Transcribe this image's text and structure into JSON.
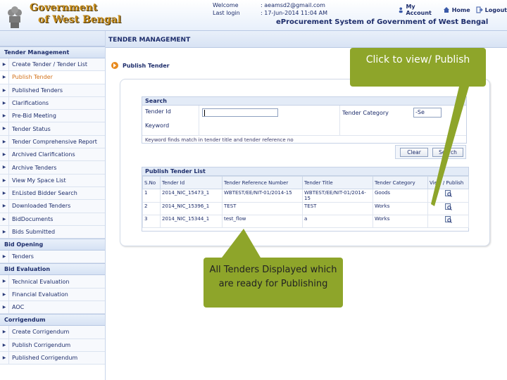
{
  "header": {
    "logo_line1": "Government",
    "logo_line2": "of West Bengal",
    "welcome_label": "Welcome",
    "welcome_value": ": aeamsd2@gmail.com",
    "lastlogin_label": "Last login",
    "lastlogin_value": ": 17-Jun-2014 11:04 AM",
    "links": {
      "account": "My Account",
      "home": "Home",
      "logout": "Logout"
    },
    "system_title": "eProcurement System of Government of West Bengal"
  },
  "sidebar": {
    "sections": [
      {
        "title": "Tender Management",
        "items": [
          "Create Tender / Tender List",
          "Publish Tender",
          "Published Tenders",
          "Clarifications",
          "Pre-Bid Meeting",
          "Tender Status",
          "Tender Comprehensive Report",
          "Archived Clarifications",
          "Archive Tenders",
          "View My Space List",
          "EnListed Bidder Search",
          "Downloaded Tenders",
          "BidDocuments",
          "Bids Submitted"
        ]
      },
      {
        "title": "Bid Opening",
        "items": [
          "Tenders"
        ]
      },
      {
        "title": "Bid Evaluation",
        "items": [
          "Technical Evaluation",
          "Financial Evaluation",
          "AOC"
        ]
      },
      {
        "title": "Corrigendum",
        "items": [
          "Create Corrigendum",
          "Publish Corrigendum",
          "Published Corrigendum"
        ]
      }
    ],
    "active_item": "Publish Tender"
  },
  "main": {
    "page_title": "TENDER MANAGEMENT",
    "sub_title": "Publish Tender",
    "search": {
      "title": "Search",
      "tender_id_label": "Tender Id",
      "tender_id_value": "",
      "keyword_label": "Keyword",
      "category_label": "Tender Category",
      "category_selected": "-Se",
      "note": "Keyword finds match in tender title and tender reference no",
      "clear_label": "Clear",
      "search_label": "Search"
    },
    "list": {
      "title": "Publish Tender List",
      "columns": [
        "S.No",
        "Tender Id",
        "Tender Reference Number",
        "Tender Title",
        "Tender Category",
        "View / Publish"
      ],
      "rows": [
        {
          "sno": "1",
          "tender_id": "2014_NIC_15473_1",
          "ref": "WBTEST/EE/NIT-01/2014-15",
          "title": "WBTEST/EE/NIT-01/2014-15",
          "category": "Goods"
        },
        {
          "sno": "2",
          "tender_id": "2014_NIC_15396_1",
          "ref": "TEST",
          "title": "TEST",
          "category": "Works"
        },
        {
          "sno": "3",
          "tender_id": "2014_NIC_15344_1",
          "ref": "test_flow",
          "title": "a",
          "category": "Works"
        }
      ]
    }
  },
  "callouts": {
    "top": "Click to view/ Publish",
    "bottom": "All Tenders Displayed which are ready for Publishing"
  },
  "colors": {
    "callout": "#8ea52a",
    "active_menu": "#d2711a",
    "primary_text": "#1d2d6b"
  }
}
